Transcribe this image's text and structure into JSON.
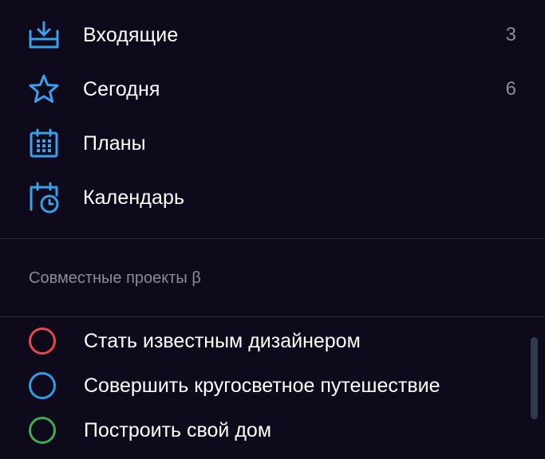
{
  "colors": {
    "background": "#0e0a1b",
    "icon_blue": "#3aa0ea",
    "project_red": "#e5484d",
    "project_blue": "#2f9de8",
    "project_green": "#3fae4e",
    "muted_text": "#8b8a97"
  },
  "nav": {
    "items": [
      {
        "label": "Входящие",
        "count": "3",
        "icon": "inbox-icon"
      },
      {
        "label": "Сегодня",
        "count": "6",
        "icon": "star-icon"
      },
      {
        "label": "Планы",
        "count": "",
        "icon": "calendar-grid-icon"
      },
      {
        "label": "Календарь",
        "count": "",
        "icon": "calendar-clock-icon"
      }
    ]
  },
  "shared": {
    "title": "Совместные проекты β",
    "projects": [
      {
        "label": "Стать известным дизайнером",
        "color": "red"
      },
      {
        "label": "Совершить кругосветное путешествие",
        "color": "blue"
      },
      {
        "label": "Построить свой дом",
        "color": "green"
      }
    ]
  }
}
